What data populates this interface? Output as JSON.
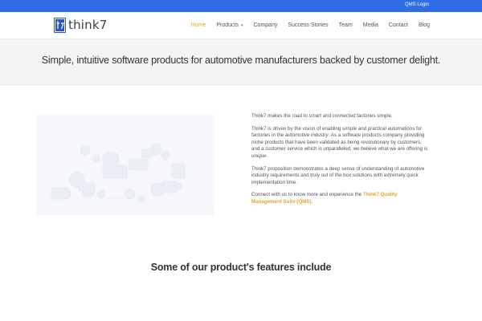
{
  "topbar": {
    "qms_login": "QMS Login"
  },
  "header": {
    "logo_text": "think7",
    "nav": [
      {
        "label": "Home",
        "active": true
      },
      {
        "label": "Products",
        "has_dropdown": true
      },
      {
        "label": "Company"
      },
      {
        "label": "Success Stories"
      },
      {
        "label": "Team"
      },
      {
        "label": "Media"
      },
      {
        "label": "Contact"
      },
      {
        "label": "Blog"
      }
    ]
  },
  "hero": {
    "headline": "Simple, intuitive software products for automotive manufacturers backed by customer delight."
  },
  "intro": {
    "p1": {
      "a": "Think7 makes the road to ",
      "b": "smart",
      "c": " and ",
      "d": "connected",
      "e": " factories simple."
    },
    "p2": {
      "a": "Think7 is driven by the vision of enabling ",
      "b": "simple",
      "c": " and ",
      "d": "practical",
      "e": " automations for factories in the ",
      "f": "automotive industry",
      "g": ". As a software products company providing niche products that have been validated as being revolutionary by customers, and a customer service which is unparalleled, we believe what we are offering is ",
      "h": "unique",
      "i": "."
    },
    "p3": "Think7 proposition demonstrates a deep sense of understanding of automotive industry requirements and truly out of the box solutions with extremely quick implementation time.",
    "p4": {
      "a": "Connect with us to know more and experience the ",
      "link": "Think7 Quality Management Suite (QMS)",
      "b": "."
    }
  },
  "features": {
    "title": "Some of our product's features include"
  },
  "colors": {
    "topbar": "#2f6ee6",
    "accent": "#e3a72b",
    "logo": "#2a57b8",
    "hero_bg": "#f4f4f4"
  },
  "icons": [
    "logo-icon",
    "chevron-down-icon",
    "factory-illustration"
  ]
}
